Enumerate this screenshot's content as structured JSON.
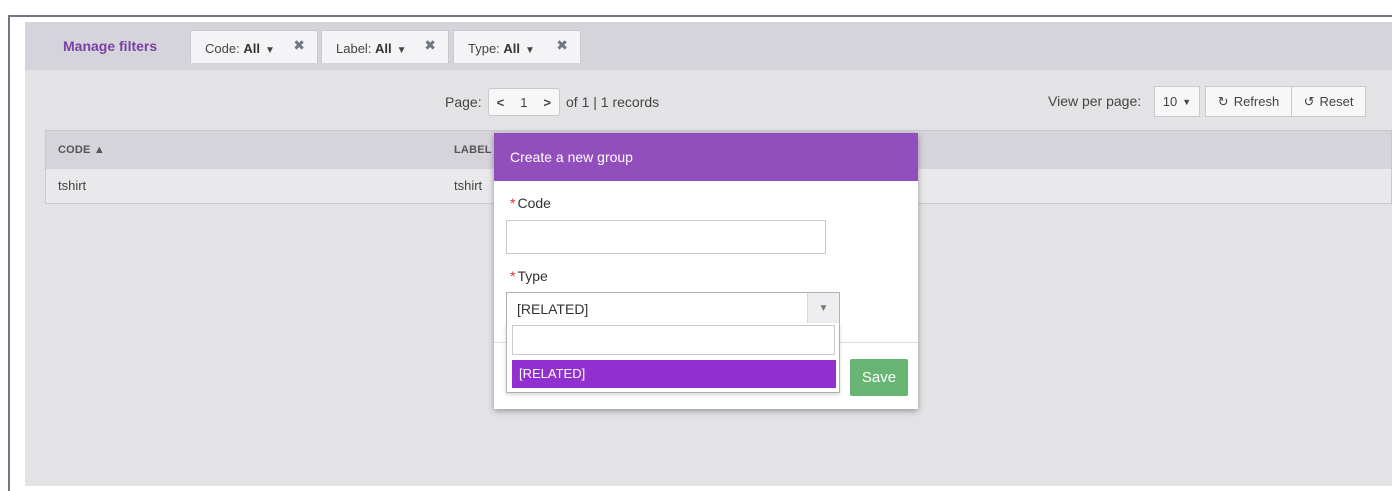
{
  "filters": {
    "manage_label": "Manage filters",
    "items": [
      {
        "label": "Code:",
        "value": "All"
      },
      {
        "label": "Label:",
        "value": "All"
      },
      {
        "label": "Type:",
        "value": "All"
      }
    ],
    "remove_glyph": "✖"
  },
  "pagination": {
    "page_label": "Page:",
    "prev": "<",
    "current": "1",
    "next": ">",
    "summary": "of 1 | 1 records"
  },
  "toolbar": {
    "view_per_page_label": "View per page:",
    "per_page_value": "10",
    "refresh_label": "Refresh",
    "reset_label": "Reset"
  },
  "grid": {
    "columns": [
      "CODE",
      "LABEL"
    ],
    "sort_indicator": "▲",
    "rows": [
      {
        "code": "tshirt",
        "label": "tshirt"
      }
    ]
  },
  "modal": {
    "title": "Create a new group",
    "code_label": "Code",
    "code_value": "",
    "type_label": "Type",
    "type_value": "[RELATED]",
    "type_search_value": "",
    "type_options": [
      "[RELATED]"
    ],
    "required_marker": "*",
    "save_label": "Save"
  },
  "colors": {
    "accent_purple": "#924ebc",
    "selected_option": "#9130cf",
    "manage_filters_text": "#7b3fa6",
    "save_green": "#67b475"
  }
}
